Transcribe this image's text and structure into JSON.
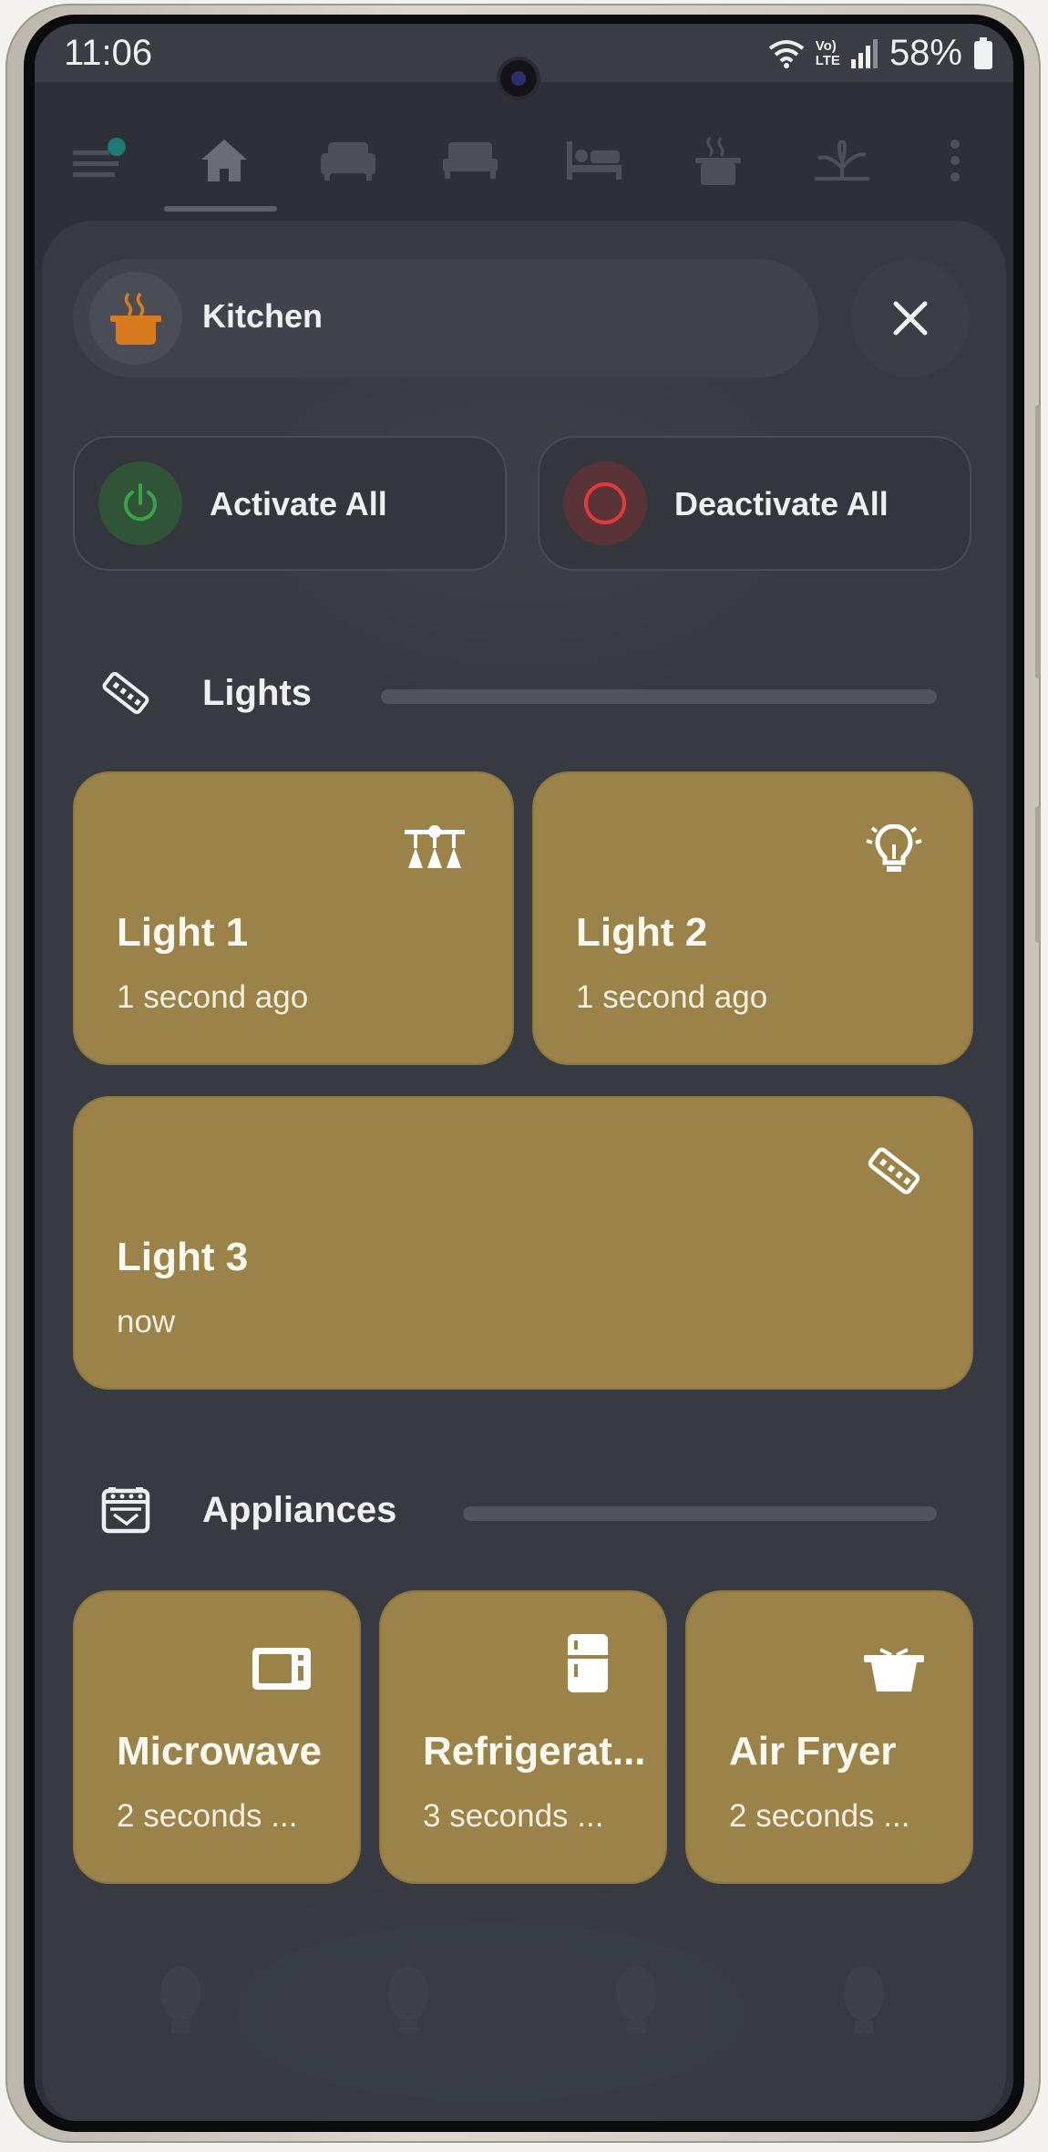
{
  "status_bar": {
    "time": "11:06",
    "battery": "58%",
    "network": "LTE",
    "volte": "Vo)",
    "icons": [
      "wifi-icon",
      "signal-icon",
      "battery-icon"
    ]
  },
  "nav": {
    "items": [
      {
        "name": "menu",
        "icon": "menu-icon"
      },
      {
        "name": "home",
        "icon": "home-icon",
        "active": true
      },
      {
        "name": "living-room",
        "icon": "sofa-icon"
      },
      {
        "name": "bedroom",
        "icon": "bed-icon"
      },
      {
        "name": "guest-room",
        "icon": "single-bed-icon"
      },
      {
        "name": "kitchen",
        "icon": "pot-icon"
      },
      {
        "name": "garden",
        "icon": "plant-icon"
      },
      {
        "name": "more",
        "icon": "more-vertical-icon"
      }
    ]
  },
  "room": {
    "title": "Kitchen",
    "icon": "cooking-pot-icon",
    "icon_color": "#d97a1e"
  },
  "actions": {
    "activate_label": "Activate All",
    "deactivate_label": "Deactivate All",
    "activate_color": "#3ea24a",
    "deactivate_color": "#e03b3b"
  },
  "lights": {
    "title": "Lights",
    "icon": "led-strip-icon",
    "tiles": [
      {
        "name": "Light 1",
        "time": "1 second ago",
        "icon": "chandelier-icon"
      },
      {
        "name": "Light 2",
        "time": "1 second ago",
        "icon": "lightbulb-icon"
      },
      {
        "name": "Light 3",
        "time": "now",
        "icon": "led-strip-icon"
      }
    ]
  },
  "appliances": {
    "title": "Appliances",
    "icon": "stove-icon",
    "tiles": [
      {
        "name": "Microwave",
        "time": "2 seconds ...",
        "icon": "microwave-icon"
      },
      {
        "name": "Refrigerat...",
        "time": "3 seconds ...",
        "icon": "fridge-icon"
      },
      {
        "name": "Air Fryer",
        "time": "2 seconds ...",
        "icon": "pot-lid-icon"
      }
    ]
  },
  "colors": {
    "tile_on": "#9a8248",
    "background": "#2d3038",
    "text": "#eef0f2"
  }
}
